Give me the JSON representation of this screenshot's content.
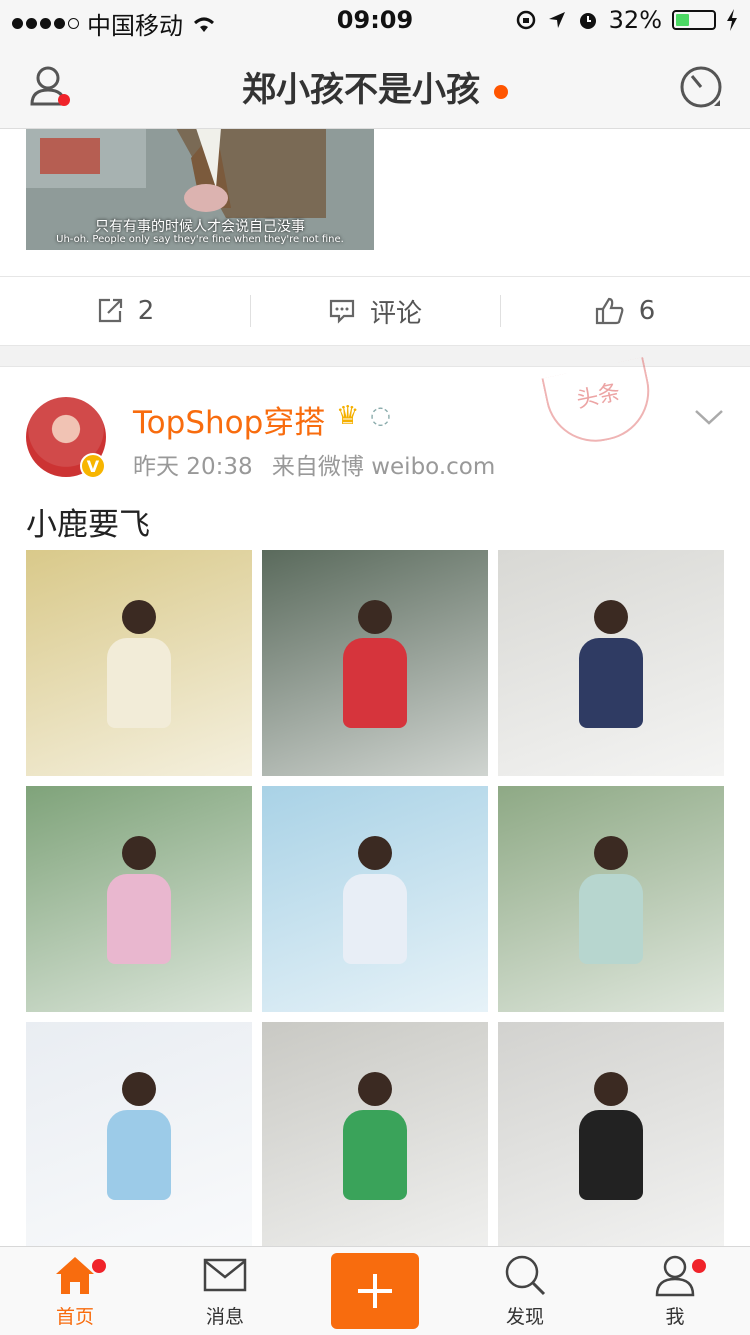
{
  "status_bar": {
    "carrier": "中国移动",
    "time": "09:09",
    "battery": "32%",
    "battery_level": 0.32,
    "icons": [
      "signal-dots-icon",
      "wifi-icon",
      "orientation-lock-icon",
      "location-arrow-icon",
      "alarm-icon",
      "battery-icon",
      "charging-bolt-icon"
    ]
  },
  "nav": {
    "title": "郑小孩不是小孩",
    "left_icon": "profile-icon",
    "right_icon": "radar-icon"
  },
  "prev_post": {
    "caption_cn": "只有有事的时候人才会说自己没事",
    "caption_en": "Uh-oh. People only say they're fine when they're not fine.",
    "actions": {
      "repost_count": "2",
      "comment_label": "评论",
      "like_count": "6"
    }
  },
  "post": {
    "username": "TopShop穿搭",
    "verified": "V",
    "time": "昨天 20:38",
    "source": "来自微博 weibo.com",
    "stamp": "头条",
    "text": "小鹿要飞",
    "images": [
      {
        "bg": "#d9c98a",
        "accent": "#f2ecd8"
      },
      {
        "bg": "#5a6a5c",
        "accent": "#d6343c"
      },
      {
        "bg": "#d8d8d4",
        "accent": "#2f3b63"
      },
      {
        "bg": "#7fa37a",
        "accent": "#e9b7cf"
      },
      {
        "bg": "#a9d2e6",
        "accent": "#e8eef6"
      },
      {
        "bg": "#8ea985",
        "accent": "#b7d6cf"
      },
      {
        "bg": "#e9edf2",
        "accent": "#9ccbe8"
      },
      {
        "bg": "#c9c9c4",
        "accent": "#3aa35a"
      },
      {
        "bg": "#d2d2cf",
        "accent": "#222222"
      }
    ]
  },
  "tabbar": {
    "home": "首页",
    "messages": "消息",
    "discover": "发现",
    "me": "我",
    "accent": "#f86c0e"
  }
}
